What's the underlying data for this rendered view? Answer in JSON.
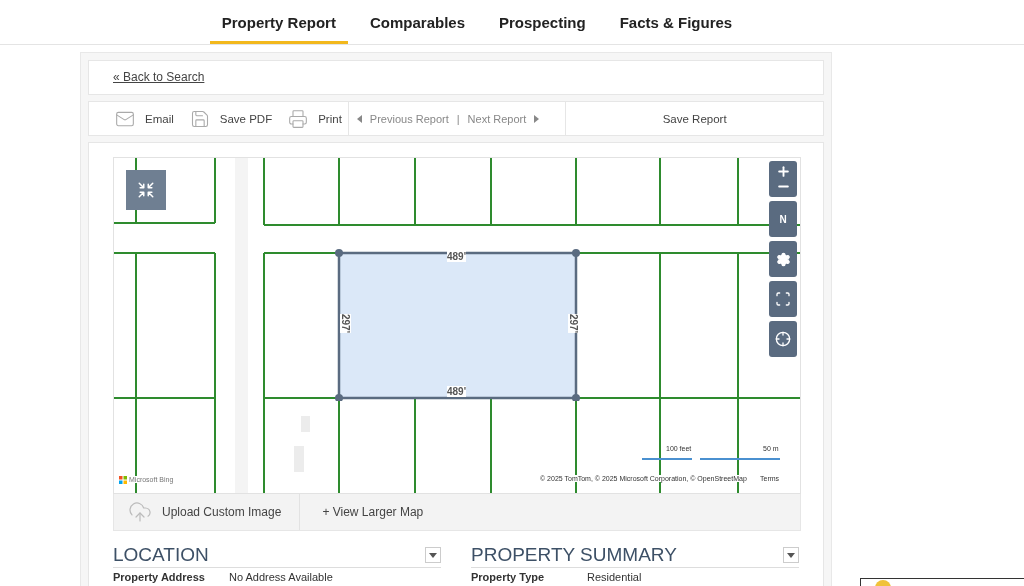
{
  "nav": {
    "tabs": [
      {
        "label": "Property Report",
        "selected": true
      },
      {
        "label": "Comparables",
        "selected": false
      },
      {
        "label": "Prospecting",
        "selected": false
      },
      {
        "label": "Facts & Figures",
        "selected": false
      }
    ]
  },
  "back_link": "« Back to Search",
  "toolbar": {
    "actions": [
      {
        "kind": "email",
        "label": "Email"
      },
      {
        "kind": "pdf",
        "label": "Save PDF"
      },
      {
        "kind": "print",
        "label": "Print"
      }
    ],
    "previous": "Previous Report",
    "separator": "|",
    "next": "Next Report",
    "save": "Save Report"
  },
  "map": {
    "parcel": {
      "top": "489'",
      "bottom": "489'",
      "left": "297'",
      "right": "297'"
    },
    "scale": [
      "100 feet",
      "50 m"
    ],
    "brand": "Microsoft Bing",
    "attribution": "© 2025 TomTom, © 2025 Microsoft Corporation, © OpenStreetMap",
    "terms": "Terms",
    "compass": "N",
    "upload": "Upload Custom Image",
    "larger": "+ View Larger Map"
  },
  "sections": [
    {
      "title": "LOCATION",
      "rows": [
        {
          "label": "Property Address",
          "value": "No Address Available"
        }
      ]
    },
    {
      "title": "PROPERTY SUMMARY",
      "rows": [
        {
          "label": "Property Type",
          "value": "Residential"
        }
      ]
    }
  ]
}
